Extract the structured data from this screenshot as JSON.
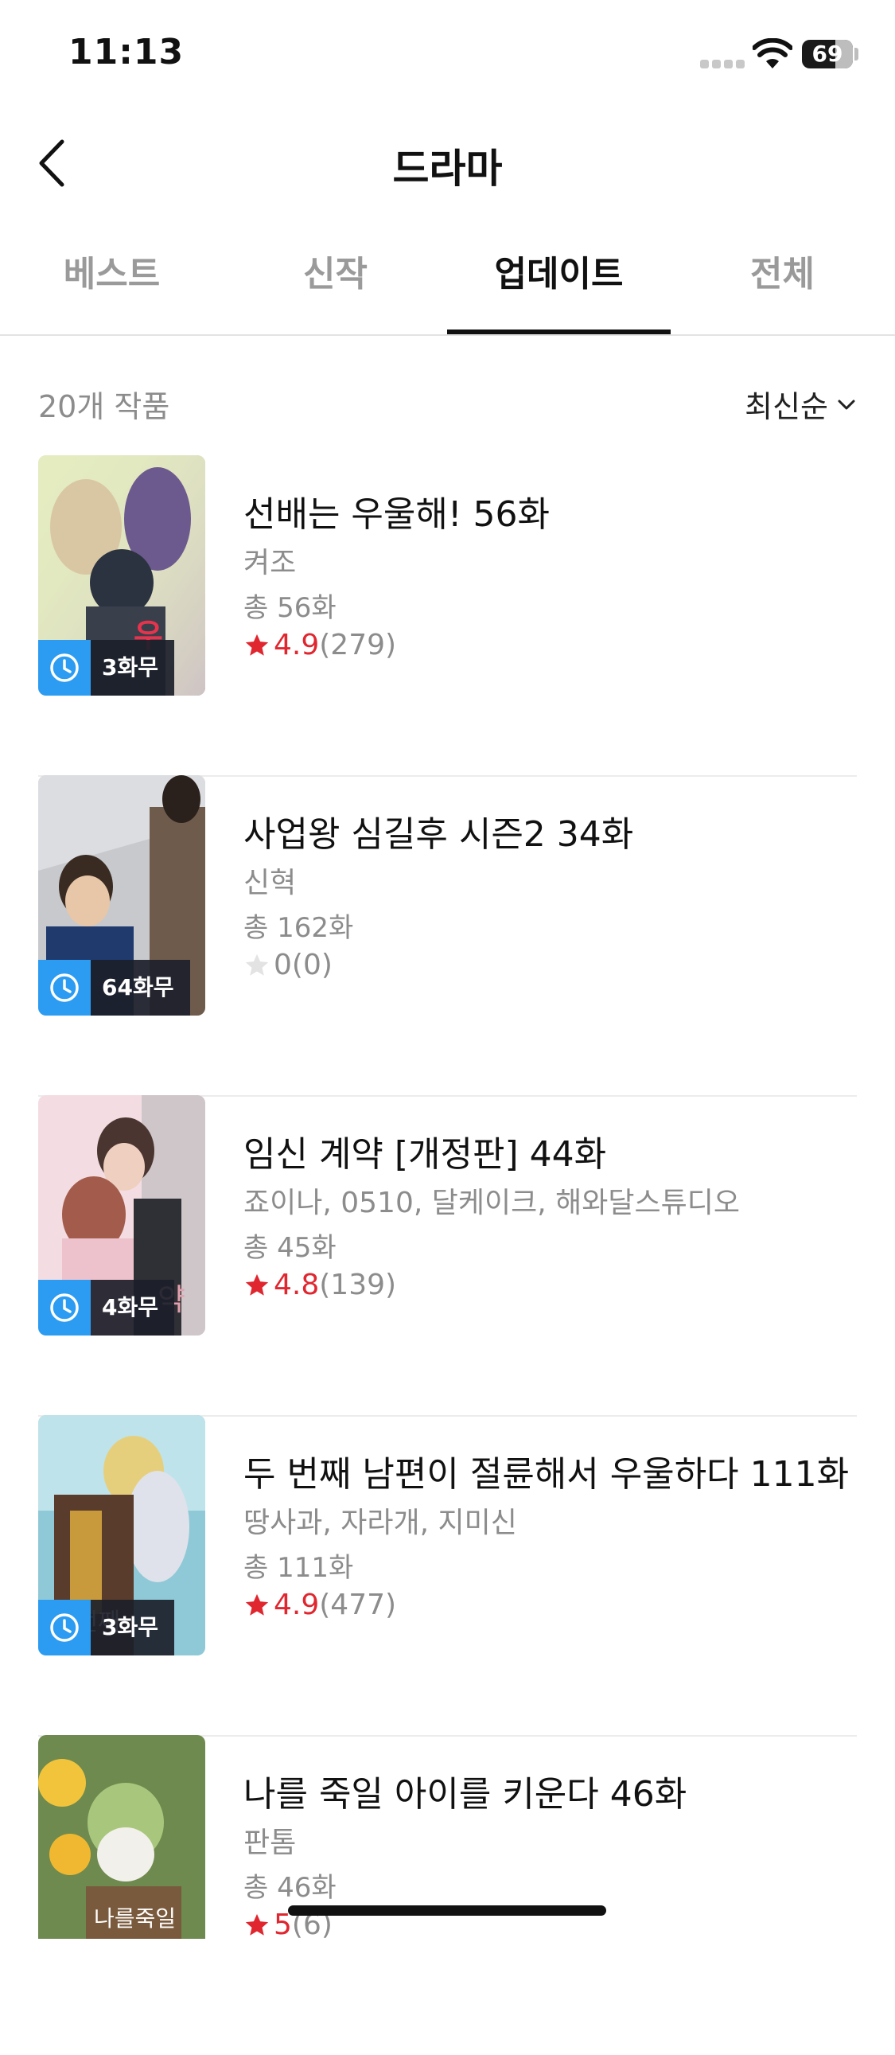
{
  "status_bar": {
    "time": "11:13",
    "battery": "69"
  },
  "header": {
    "title": "드라마"
  },
  "tabs": [
    {
      "label": "베스트",
      "active": false
    },
    {
      "label": "신작",
      "active": false
    },
    {
      "label": "업데이트",
      "active": true
    },
    {
      "label": "전체",
      "active": false
    }
  ],
  "list_header": {
    "count": "20개 작품",
    "sort_label": "최신순"
  },
  "items": [
    {
      "title": "선배는 우울해! 56화",
      "author": "켜조",
      "episodes": "총 56화",
      "rating": "4.9",
      "rating_count": "(279)",
      "free_badge": "3화무"
    },
    {
      "title": "사업왕 심길후 시즌2 34화",
      "author": "신혁",
      "episodes": "총 162화",
      "rating": "0",
      "rating_count": "(0)",
      "free_badge": "64화무"
    },
    {
      "title": "임신 계약 [개정판] 44화",
      "author": "죠이나, 0510, 달케이크, 해와달스튜디오",
      "episodes": "총 45화",
      "rating": "4.8",
      "rating_count": "(139)",
      "free_badge": "4화무"
    },
    {
      "title": "두 번째 남편이 절륜해서 우울하다 111화",
      "author": "땅사과, 자라개, 지미신",
      "episodes": "총 111화",
      "rating": "4.9",
      "rating_count": "(477)",
      "free_badge": "3화무"
    },
    {
      "title": "나를 죽일 아이를 키운다 46화",
      "author": "판톰",
      "episodes": "총 46화",
      "rating": "5",
      "rating_count": "(6)",
      "free_badge": ""
    }
  ],
  "colors": {
    "accent_blue": "#2b9cf2",
    "rating_red": "#e0262f",
    "muted_gray": "#8c8c8c"
  },
  "icons": {
    "back": "chevron-left-icon",
    "sort": "chevron-down-icon",
    "badge": "clock-icon",
    "rating": "star-icon"
  }
}
